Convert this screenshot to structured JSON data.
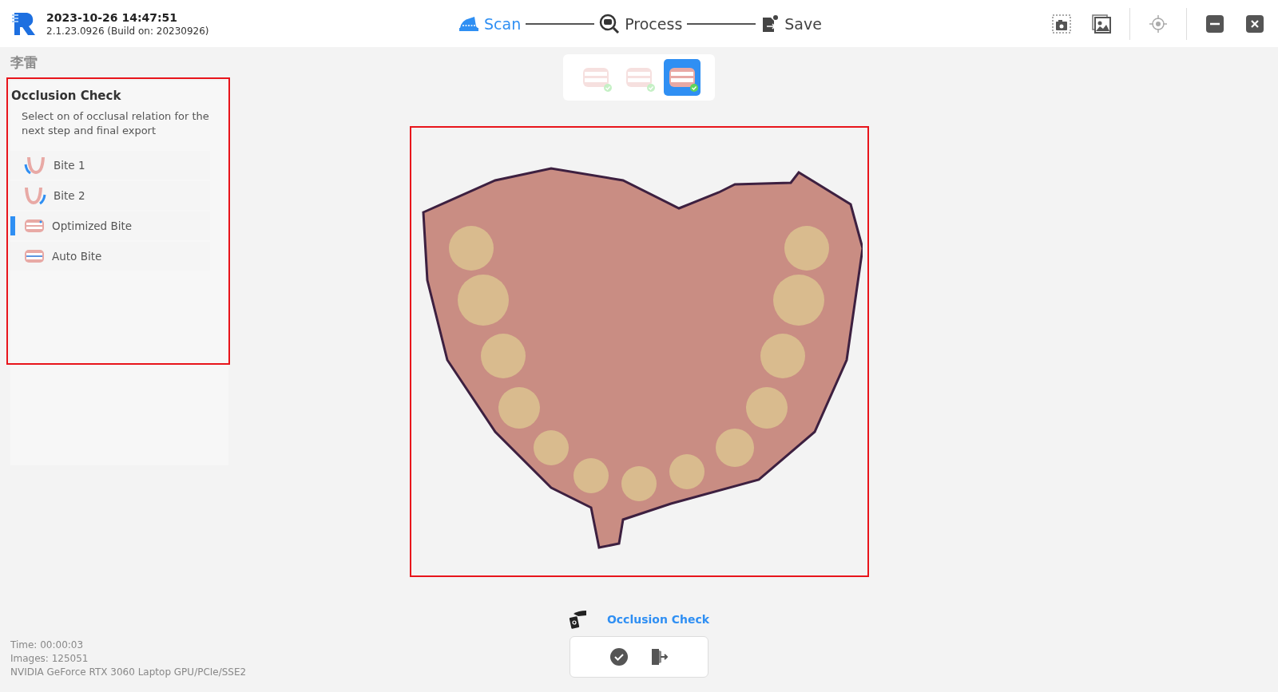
{
  "header": {
    "datetime": "2023-10-26 14:47:51",
    "version": "2.1.23.0926 (Build on: 20230926)",
    "steps": [
      {
        "label": "Scan",
        "selected": true
      },
      {
        "label": "Process",
        "selected": false
      },
      {
        "label": "Save",
        "selected": false
      }
    ]
  },
  "patient_name": "李雷",
  "bite_thumbnails": [
    {
      "selected": false
    },
    {
      "selected": false
    },
    {
      "selected": true
    }
  ],
  "panel": {
    "title": "Occlusion Check",
    "description": "Select on of occlusal relation for the next step and final export",
    "items": [
      {
        "label": "Bite 1",
        "kind": "bite-left",
        "selected": false
      },
      {
        "label": "Bite 2",
        "kind": "bite-right",
        "selected": false
      },
      {
        "label": "Optimized Bite",
        "kind": "optimized",
        "selected": true
      },
      {
        "label": "Auto Bite",
        "kind": "auto",
        "selected": false
      }
    ]
  },
  "stats": [
    "Time: 00:00:03",
    "Images: 125051",
    "NVIDIA GeForce RTX 3060 Laptop GPU/PCIe/SSE2"
  ],
  "tool": {
    "label": "Occlusion Check"
  }
}
